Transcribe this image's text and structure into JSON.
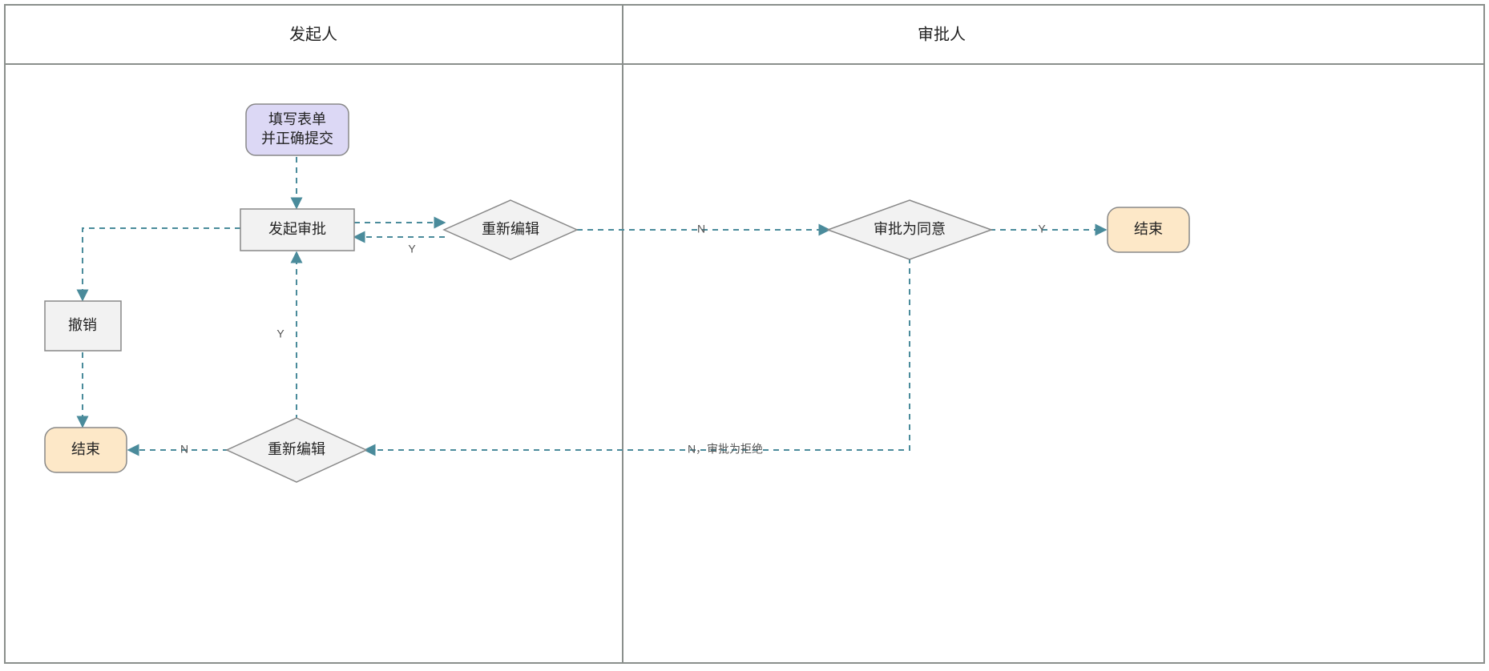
{
  "lanes": {
    "initiator": "发起人",
    "approver": "审批人"
  },
  "nodes": {
    "start": {
      "label1": "填写表单",
      "label2": "并正确提交"
    },
    "initiate": {
      "label": "发起审批"
    },
    "revoke": {
      "label": "撤销"
    },
    "end_left": {
      "label": "结束"
    },
    "reedit_top": {
      "label": "重新编辑"
    },
    "reedit_bottom": {
      "label": "重新编辑"
    },
    "approve": {
      "label": "审批为同意"
    },
    "end_right": {
      "label": "结束"
    }
  },
  "edge_labels": {
    "reedit_top_to_initiate": "Y",
    "reedit_top_to_approve": "N",
    "approve_to_end": "Y",
    "approve_to_reedit_bottom": "N，审批为拒绝",
    "reedit_bottom_to_initiate": "Y",
    "reedit_bottom_to_end": "N"
  }
}
